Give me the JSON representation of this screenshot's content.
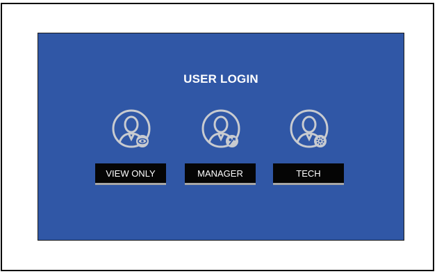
{
  "login": {
    "title": "USER LOGIN",
    "users": [
      {
        "label": "VIEW ONLY",
        "icon": "user-view-icon"
      },
      {
        "label": "MANAGER",
        "icon": "user-manager-icon"
      },
      {
        "label": "TECH",
        "icon": "user-tech-icon"
      }
    ]
  },
  "colors": {
    "panel": "#3057a6",
    "button": "#050505",
    "button_underline": "#a7a7a7",
    "icon": "#c8cbd0"
  }
}
